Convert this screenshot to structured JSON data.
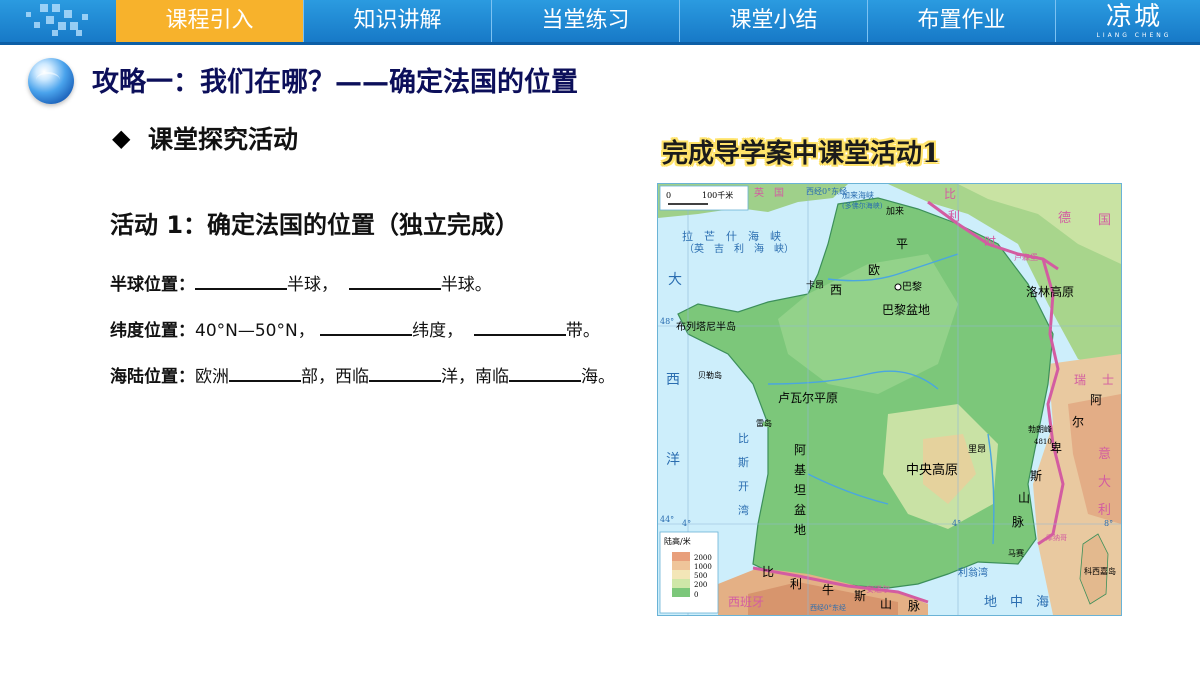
{
  "nav": {
    "tabs": [
      "课程引入",
      "知识讲解",
      "当堂练习",
      "课堂小结",
      "布置作业"
    ],
    "active_index": 0
  },
  "logo": {
    "text": "凉城",
    "sub": "LIANG CHENG"
  },
  "heading": "攻略一：我们在哪？——确定法国的位置",
  "section": {
    "marker": "◆",
    "title": "课堂探究活动"
  },
  "activity": {
    "title": "活动 1：确定法国的位置（独立完成）",
    "rows": [
      {
        "label": "半球位置：",
        "parts": [
          "",
          "半球，",
          "",
          "半球。"
        ]
      },
      {
        "label": "纬度位置：",
        "parts": [
          "40°N—50°N，",
          "",
          "纬度，",
          "",
          "带。"
        ]
      },
      {
        "label": "海陆位置：",
        "parts": [
          "欧洲",
          "",
          "部，西临",
          "",
          "洋，南临",
          "",
          "海。"
        ]
      }
    ]
  },
  "map": {
    "caption": "完成导学案中课堂活动1",
    "scale": {
      "zero": "0",
      "dist": "100千米"
    },
    "legend": {
      "title": "陆高/米",
      "levels": [
        "2000",
        "1000",
        "500",
        "200",
        "0"
      ]
    },
    "labels": {
      "uk": "英　国",
      "lon_east": "西经0°东经",
      "channel": "拉　芒　什　海　峡",
      "channel_en": "（英　吉　利　海　峡）",
      "dover": "加来海峡",
      "dover_sub": "(多佛尔海峡)",
      "calais": "加来",
      "belgium_1": "比",
      "belgium_2": "利",
      "belgium_3": "时",
      "lux": "卢森堡",
      "germany_1": "德",
      "germany_2": "国",
      "atlantic_1": "大",
      "atlantic_2": "西",
      "atlantic_3": "洋",
      "caen": "卡昂",
      "paris": "巴黎",
      "basin": "巴黎盆地",
      "plain_1": "西",
      "plain_2": "欧",
      "plain_3": "平",
      "lorraine": "洛林高原",
      "brittany": "布列塔尼半岛",
      "belle": "贝勒岛",
      "loire": "卢瓦尔平原",
      "re": "雷岛",
      "biscay_1": "比",
      "biscay_2": "斯",
      "biscay_3": "开",
      "biscay_4": "湾",
      "central": "中央高原",
      "lyon": "里昂",
      "mont_blanc": "勃朗峰",
      "mont_blanc_h": "4810",
      "swiss_1": "瑞",
      "swiss_2": "士",
      "alps_1": "阿",
      "alps_2": "尔",
      "alps_3": "卑",
      "alps_4": "斯",
      "alps_5": "山",
      "alps_6": "脉",
      "italy_1": "意",
      "italy_2": "大",
      "italy_3": "利",
      "aquitaine_1": "阿",
      "aquitaine_2": "基",
      "aquitaine_3": "坦",
      "aquitaine_4": "盆",
      "aquitaine_5": "地",
      "lion_gulf": "利翁湾",
      "marseille": "马赛",
      "monaco": "摩纳哥",
      "corsica": "科西嘉岛",
      "pyrenees_1": "比",
      "pyrenees_2": "利",
      "pyrenees_3": "牛",
      "pyrenees_4": "斯",
      "pyrenees_5": "山",
      "pyrenees_6": "脉",
      "spain": "西班牙",
      "andorra": "安道尔",
      "med": "地　中　海",
      "lon_east2": "西经0°东经",
      "lat48": "48°",
      "lat44": "44°",
      "lon4w": "4°",
      "lon4e": "4°",
      "lon8": "8°"
    }
  }
}
